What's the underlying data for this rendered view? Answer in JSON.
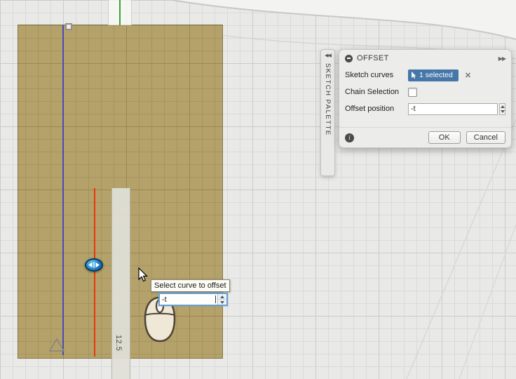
{
  "colors": {
    "canvas-bg": "#e9e9e7",
    "grid-minor": "#dadad8",
    "grid-major": "#cbcbc9",
    "body-tan": "#b4a26a",
    "tan-grid-minor": "#a6945d",
    "tan-grid-major": "#9a8850",
    "sketch-blue": "#4a4ab8",
    "selected-red": "#e8380d",
    "construction-green": "#3f9e3f",
    "manipulator-blue": "#1b79c4",
    "chip-blue": "#4677a9",
    "focus-border": "#6b9fce"
  },
  "canvas": {
    "tooltip": "Select curve to offset",
    "inline_input_value": "-t",
    "dimension": "12.5"
  },
  "palette": {
    "collapse_icon": "◀◀",
    "title": "SKETCH PALETTE"
  },
  "dialog": {
    "title": "OFFSET",
    "collapse_icon": "▶▶",
    "fields": {
      "sketch_curves": {
        "label": "Sketch curves",
        "value": "1 selected",
        "clear_icon": "✕"
      },
      "chain_selection": {
        "label": "Chain Selection"
      },
      "offset_position": {
        "label": "Offset position",
        "value": "-t"
      }
    },
    "info_icon": "i",
    "buttons": {
      "ok": "OK",
      "cancel": "Cancel"
    }
  }
}
